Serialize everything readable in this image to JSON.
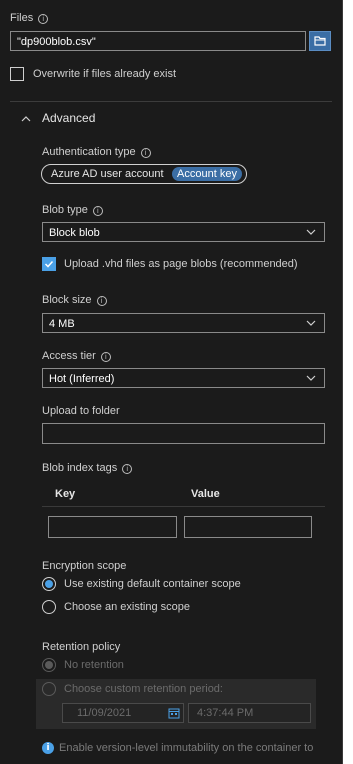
{
  "files": {
    "label": "Files",
    "info_glyph": "i",
    "value": "\"dp900blob.csv\"",
    "browse_icon": "folder-icon"
  },
  "overwrite": {
    "label": "Overwrite if files already exist",
    "checked": false
  },
  "advanced": {
    "label": "Advanced",
    "expanded": true,
    "auth": {
      "label": "Authentication type",
      "options": [
        "Azure AD user account",
        "Account key"
      ],
      "selected": "Account key"
    },
    "blob_type": {
      "label": "Blob type",
      "value": "Block blob"
    },
    "upload_vhd": {
      "label": "Upload .vhd files as page blobs (recommended)",
      "checked": true
    },
    "block_size": {
      "label": "Block size",
      "value": "4 MB"
    },
    "access_tier": {
      "label": "Access tier",
      "value": "Hot (Inferred)"
    },
    "upload_folder": {
      "label": "Upload to folder",
      "value": ""
    },
    "index_tags": {
      "label": "Blob index tags",
      "columns": [
        "Key",
        "Value"
      ],
      "key_value": "",
      "value_value": ""
    },
    "encryption": {
      "label": "Encryption scope",
      "options": [
        "Use existing default container scope",
        "Choose an existing scope"
      ],
      "selected": "Use existing default container scope"
    },
    "retention": {
      "label": "Retention policy",
      "options": [
        "No retention",
        "Choose custom retention period:"
      ],
      "selected": "No retention",
      "date": "11/09/2021",
      "time": "4:37:44 PM"
    },
    "immutability_note": "Enable version-level immutability on the container to"
  },
  "colors": {
    "background": "#1b1b1b",
    "accent": "#4aa0e6",
    "toggle_selected": "#3b6ea5",
    "border": "#8a8a8a"
  }
}
